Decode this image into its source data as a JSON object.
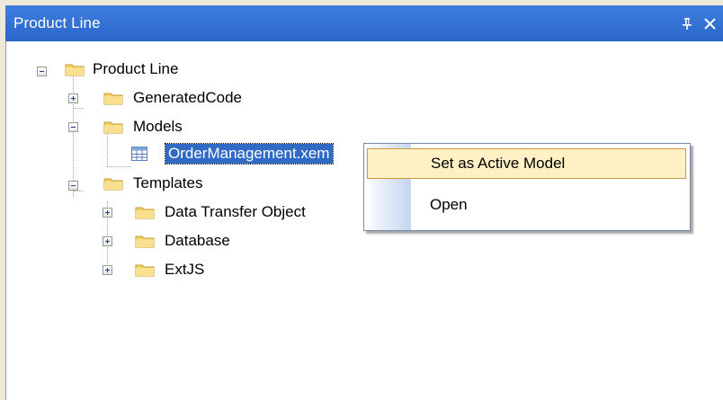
{
  "window": {
    "title": "Product Line",
    "pin_glyph": "⊥",
    "close_glyph": "✕"
  },
  "tree": {
    "root": {
      "label": "Product Line",
      "expanded": true,
      "icon": "folder-icon"
    },
    "items": [
      {
        "label": "GeneratedCode",
        "expanded": false,
        "icon": "folder-icon"
      },
      {
        "label": "Models",
        "expanded": true,
        "icon": "folder-icon",
        "children": [
          {
            "label": "OrderManagement.xem",
            "icon": "table-file-icon",
            "selected": true
          }
        ]
      },
      {
        "label": "Templates",
        "expanded": true,
        "icon": "folder-icon",
        "children": [
          {
            "label": "Data Transfer Object",
            "expanded": false,
            "icon": "folder-icon"
          },
          {
            "label": "Database",
            "expanded": false,
            "icon": "folder-icon"
          },
          {
            "label": "ExtJS",
            "expanded": false,
            "icon": "folder-icon"
          }
        ]
      }
    ]
  },
  "context_menu": {
    "items": [
      {
        "label": "Set as Active Model",
        "highlighted": true
      },
      {
        "label": "Open",
        "highlighted": false
      }
    ]
  },
  "colors": {
    "titlebar": "#2A66C8",
    "selection": "#316AC5",
    "menu_highlight": "#FFF1C4",
    "menu_highlight_border": "#C79C3E"
  }
}
